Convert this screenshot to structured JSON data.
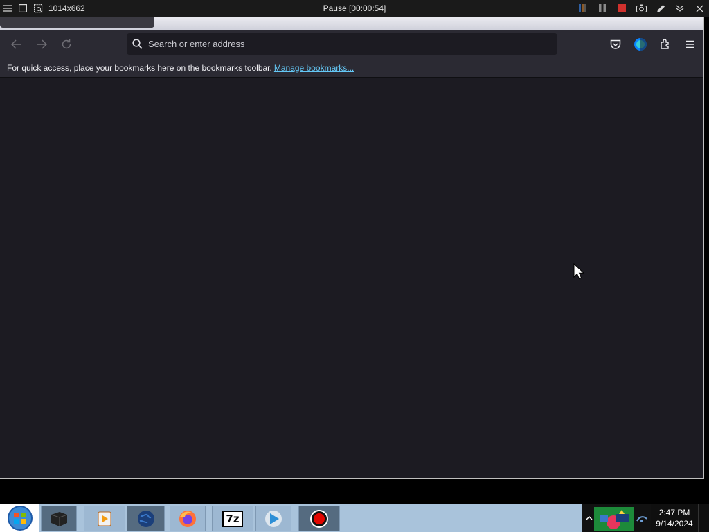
{
  "recorder": {
    "size_label": "1014x662",
    "status": "Pause [00:00:54]"
  },
  "browser": {
    "url_placeholder": "Search or enter address",
    "bookmarks_message": "For quick access, place your bookmarks here on the bookmarks toolbar.",
    "manage_bookmarks_link": "Manage bookmarks..."
  },
  "taskbar": {
    "clock_time": "2:47 PM",
    "clock_date": "9/14/2024",
    "apps": [
      {
        "name": "virtualbox-icon"
      },
      {
        "name": "media-player-icon"
      },
      {
        "name": "globe-icon"
      },
      {
        "name": "firefox-icon"
      },
      {
        "name": "7zip-icon",
        "label": "7z"
      },
      {
        "name": "play-icon"
      },
      {
        "name": "record-icon"
      }
    ]
  },
  "colors": {
    "browser_bg": "#1c1b22",
    "toolbar_bg": "#2b2a33",
    "link": "#64c8f6",
    "taskbar_bg": "#a9c3db"
  }
}
